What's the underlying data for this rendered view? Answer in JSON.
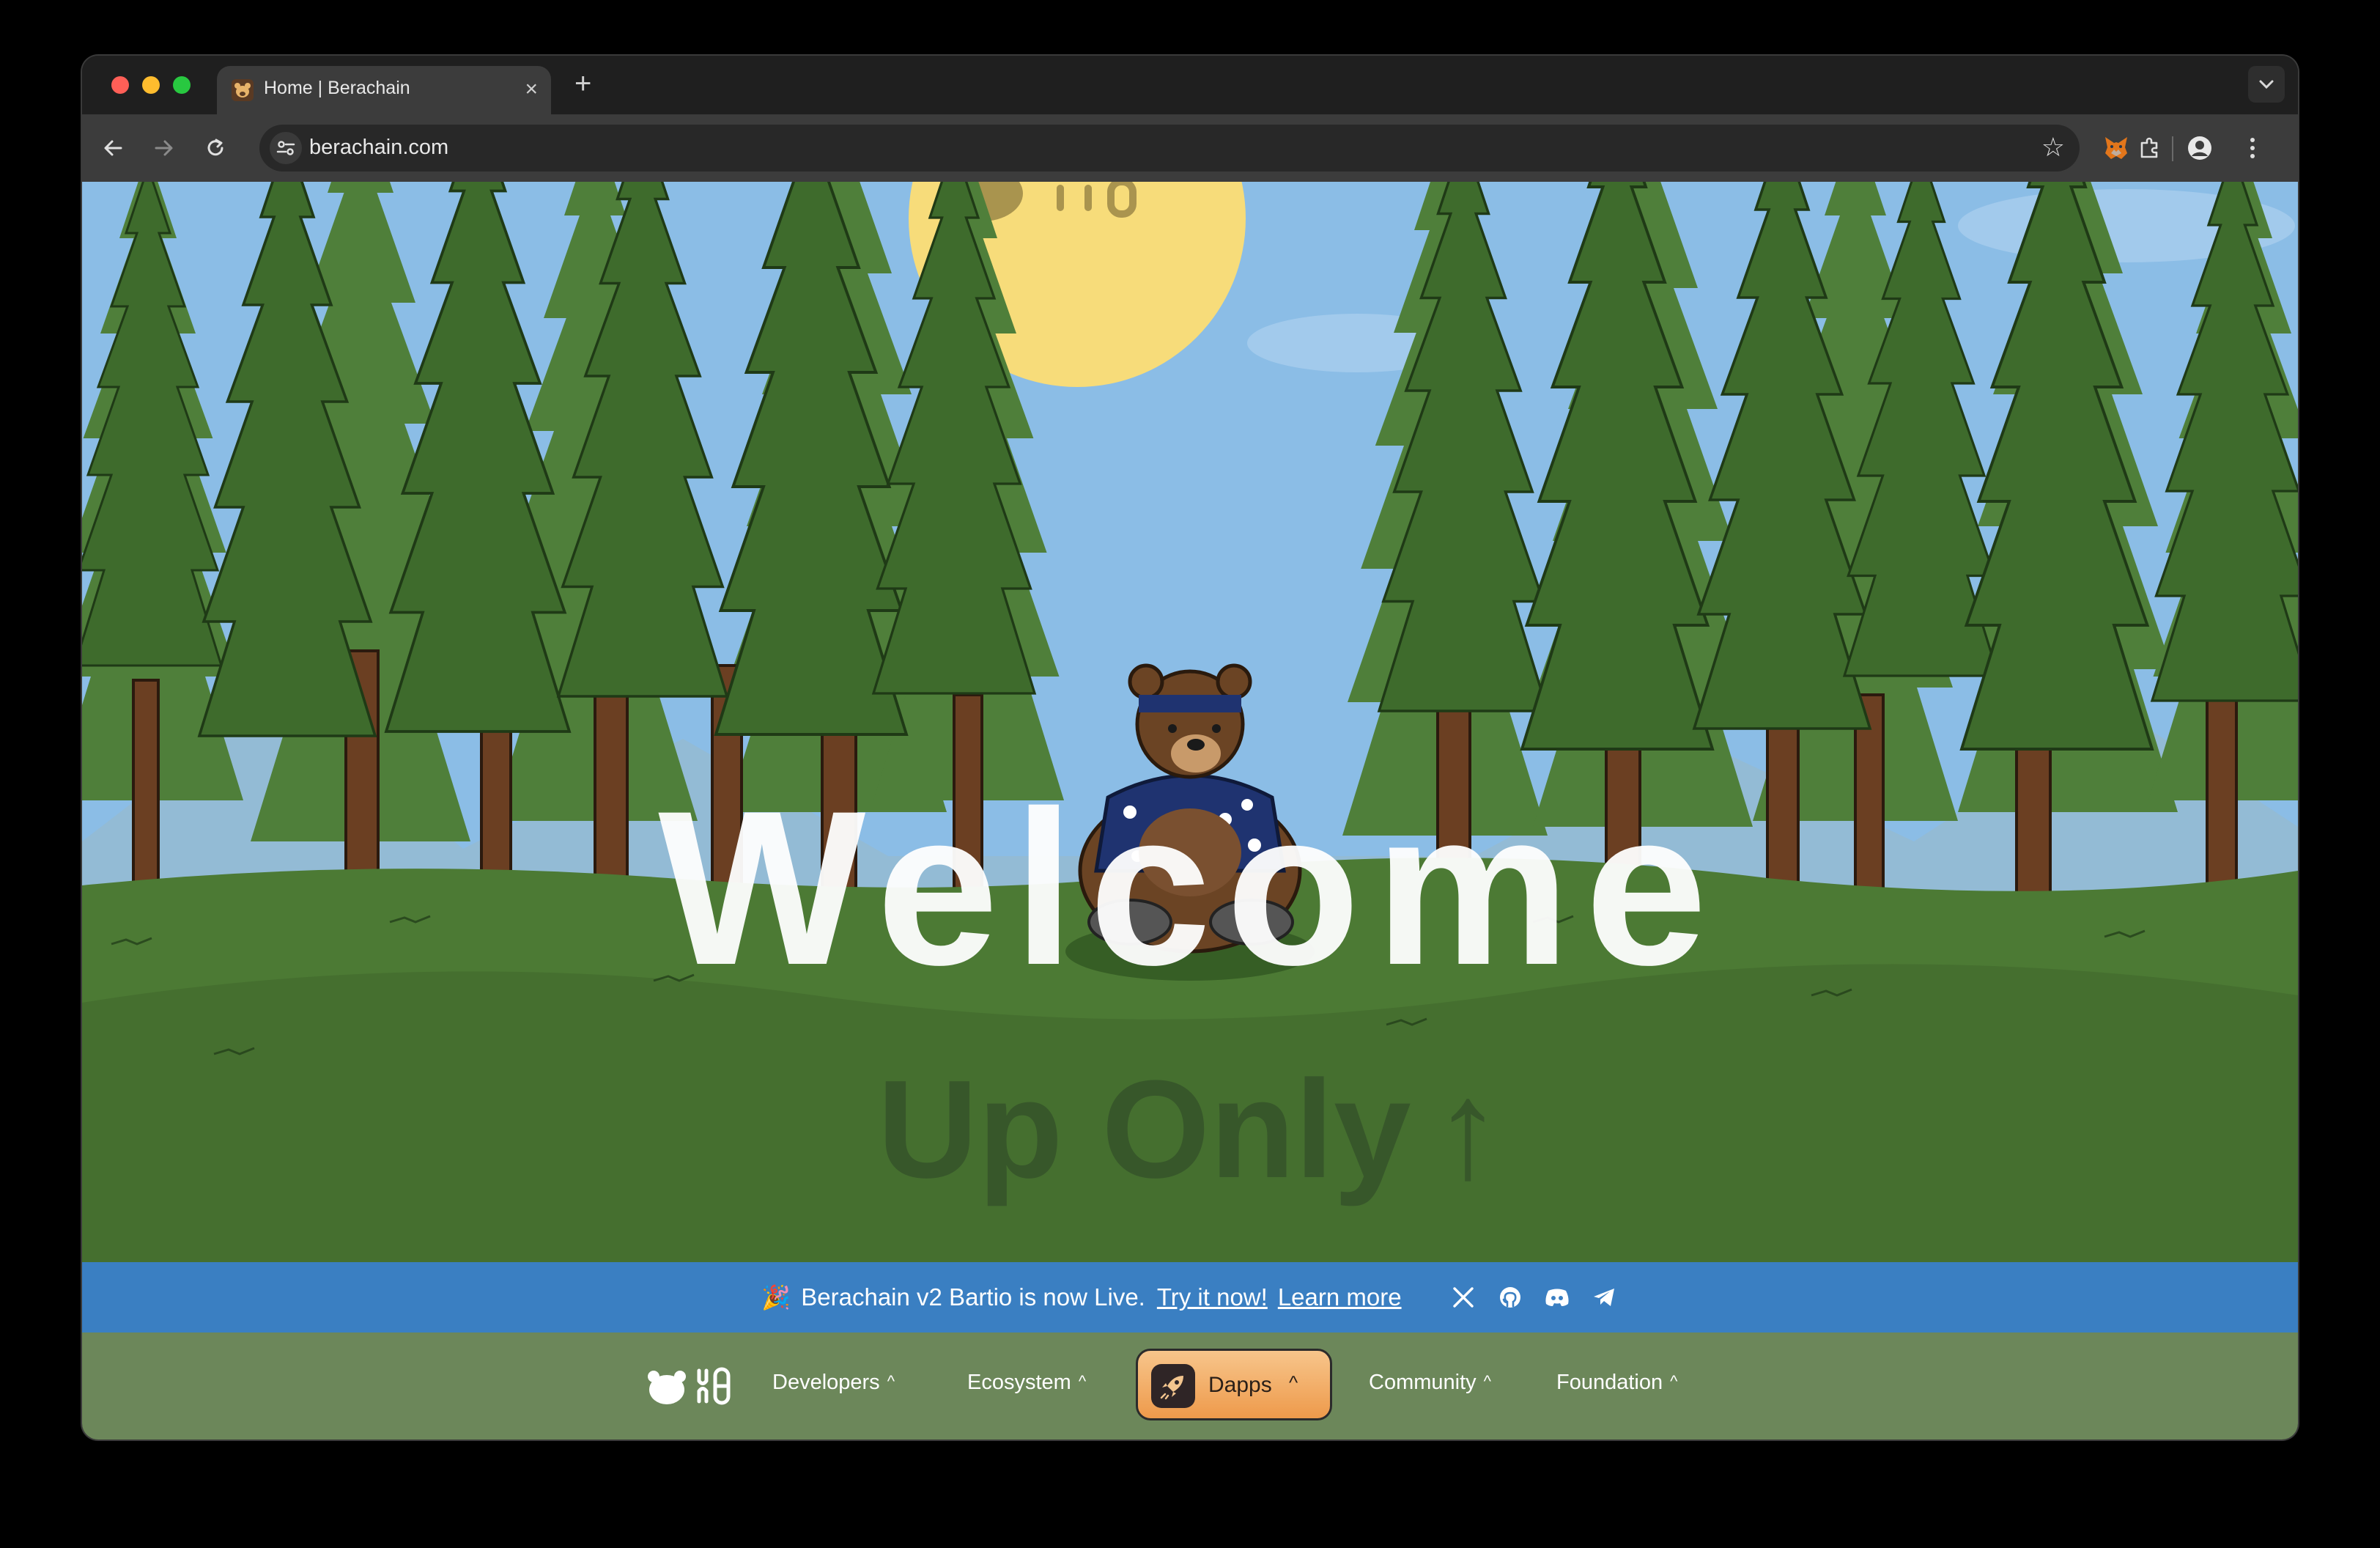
{
  "browser": {
    "tab": {
      "title": "Home | Berachain",
      "close_glyph": "×"
    },
    "new_tab_glyph": "+",
    "url": "berachain.com",
    "icons": [
      "back-arrow-icon",
      "forward-arrow-icon",
      "reload-icon",
      "site-info-icon",
      "bookmark-star-icon",
      "metamask-extension-icon",
      "extensions-puzzle-icon",
      "profile-icon",
      "kebab-menu-icon",
      "tab-search-icon"
    ]
  },
  "hero": {
    "big_text": "Welcome",
    "headline": "Up Only",
    "headline_arrow": "↑",
    "colors": {
      "sky": "#8bbde6",
      "sun": "#f7dc7a",
      "grass": "#4c7a34",
      "tree": "#3e6b2c"
    }
  },
  "banner": {
    "sparkle": "🎉",
    "message": "Berachain v2 Bartio is now Live.",
    "try_link": "Try it now!",
    "learn_link": "Learn more",
    "social_icons": [
      "x-icon",
      "github-icon",
      "discord-icon",
      "telegram-icon"
    ],
    "background": "#3a7fc2"
  },
  "nav": {
    "items": [
      {
        "label": "Developers",
        "chevron": "^"
      },
      {
        "label": "Ecosystem",
        "chevron": "^"
      },
      {
        "label": "Dapps",
        "chevron": "^"
      },
      {
        "label": "Community",
        "chevron": "^"
      },
      {
        "label": "Foundation",
        "chevron": "^"
      }
    ],
    "background": "#6c875a",
    "dapps_accent": "#f0a45a"
  }
}
